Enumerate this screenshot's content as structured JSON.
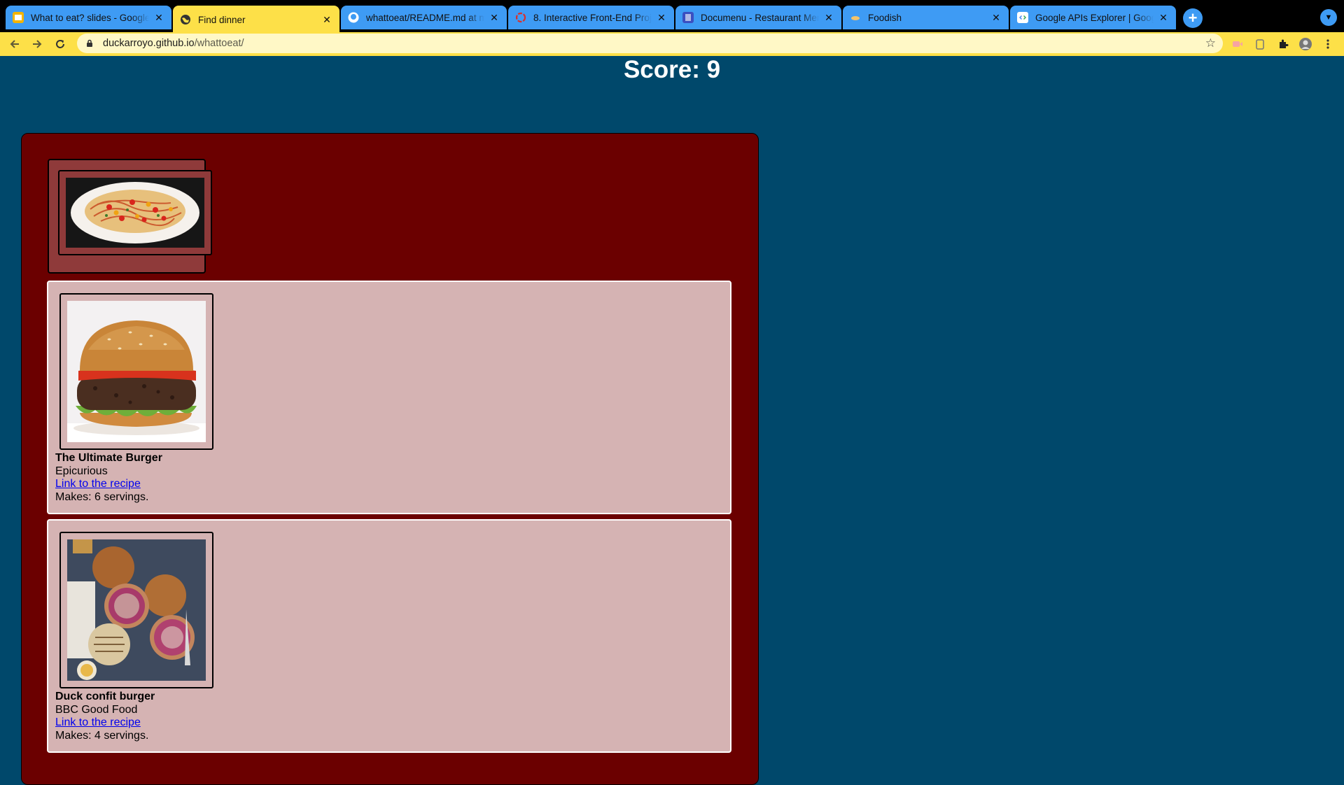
{
  "browser": {
    "tabs": [
      {
        "title": "What to eat? slides - Google Slides",
        "icon": "slides-icon"
      },
      {
        "title": "Find dinner",
        "icon": "globe-icon"
      },
      {
        "title": "whattoeat/README.md at main",
        "icon": "github-icon"
      },
      {
        "title": "8. Interactive Front-End Project",
        "icon": "ci-icon"
      },
      {
        "title": "Documenu - Restaurant Menu",
        "icon": "book-icon"
      },
      {
        "title": "Foodish",
        "icon": "food-icon"
      },
      {
        "title": "Google APIs Explorer | Google",
        "icon": "google-api-icon"
      }
    ],
    "url_host": "duckarroyo.github.io",
    "url_path": "/whattoeat/",
    "colors": {
      "accent": "#fde048",
      "tab": "#3e9bf4",
      "page_bg": "#00486b",
      "panel_bg": "#6b0000",
      "card_bg": "#d5b3b3"
    }
  },
  "page": {
    "score_text": "Score: 9",
    "recipes": [
      {
        "name": "The Ultimate Burger",
        "source": "Epicurious",
        "link_text": "Link to the recipe",
        "servings": "Makes: 6 servings."
      },
      {
        "name": "Duck confit burger",
        "source": "BBC Good Food",
        "link_text": "Link to the recipe",
        "servings": "Makes: 4 servings."
      }
    ]
  }
}
